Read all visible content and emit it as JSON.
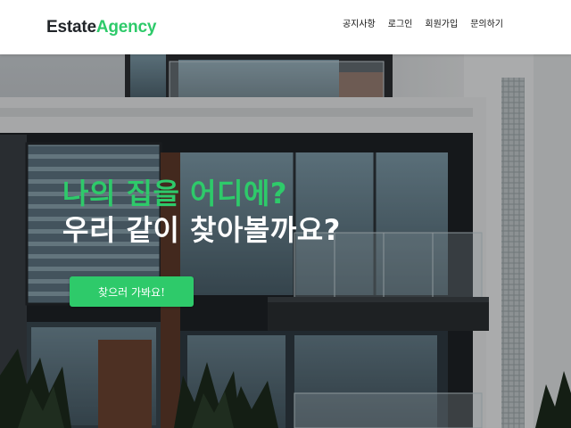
{
  "header": {
    "logo": {
      "part1": "Estate",
      "part2": "Agency"
    },
    "nav": [
      {
        "label": "공지사항"
      },
      {
        "label": "로그인"
      },
      {
        "label": "회원가입"
      },
      {
        "label": "문의하기"
      }
    ]
  },
  "hero": {
    "title_line1": "나의 집을 어디에?",
    "title_line2": "우리 같이 찾아볼까요?",
    "cta_label": "찾으러 가봐요!"
  },
  "colors": {
    "accent": "#2eca6a",
    "text_dark": "#212529",
    "header_bg": "#ffffff"
  }
}
